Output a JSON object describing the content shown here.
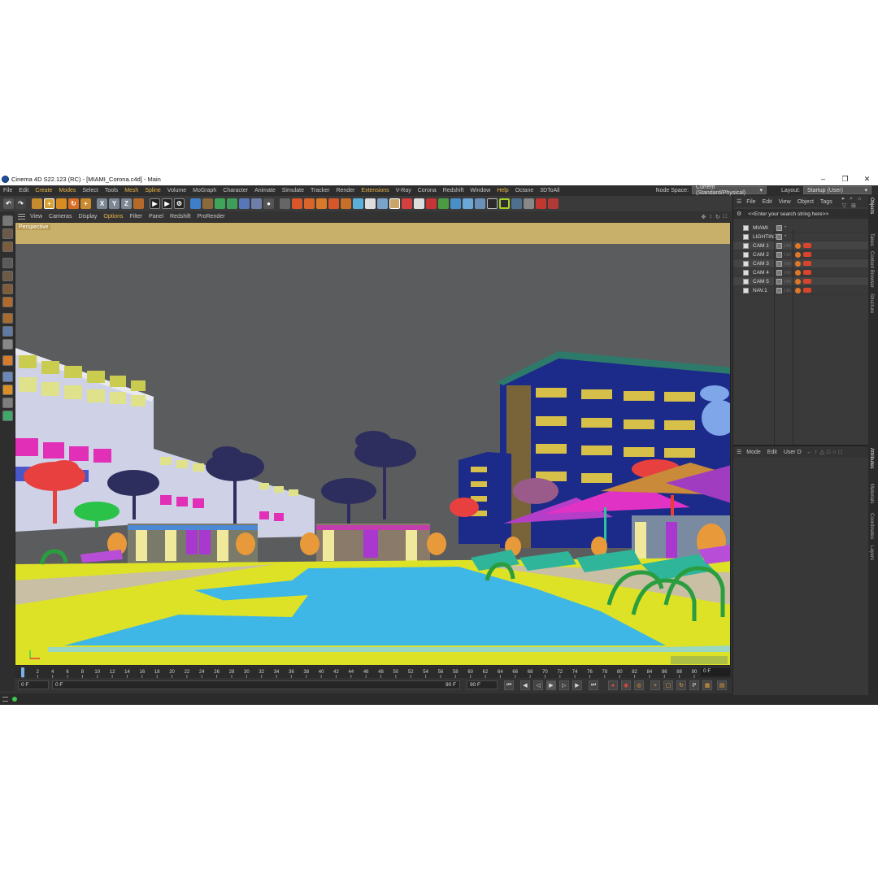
{
  "window": {
    "title": "Cinema 4D S22.123 (RC) - [MIAMI_Corona.c4d] - Main",
    "controls": [
      "–",
      "❐",
      "✕"
    ]
  },
  "menubar": {
    "items": [
      "File",
      "Edit",
      "Create",
      "Modes",
      "Select",
      "Tools",
      "Mesh",
      "Spline",
      "Volume",
      "MoGraph",
      "Character",
      "Animate",
      "Simulate",
      "Tracker",
      "Render",
      "Extensions",
      "V-Ray",
      "Corona",
      "Redshift",
      "Window",
      "Help",
      "Octane",
      "3DToAll"
    ],
    "highlighted": [
      "Create",
      "Modes",
      "Mesh",
      "Spline",
      "Extensions",
      "Help"
    ],
    "node_space_label": "Node Space:",
    "node_space_value": "Current (Standard/Physical)",
    "layout_label": "Layout:",
    "layout_value": "Startup (User)"
  },
  "toolbar": {
    "axis_buttons": [
      "X",
      "Y",
      "Z"
    ]
  },
  "viewport": {
    "menu": [
      "View",
      "Cameras",
      "Display",
      "Options",
      "Filter",
      "Panel",
      "Redshift",
      "ProRender"
    ],
    "highlighted": [
      "Options"
    ],
    "camera_label": "Perspective"
  },
  "timeline": {
    "ticks": [
      "0",
      "2",
      "4",
      "6",
      "8",
      "10",
      "12",
      "14",
      "16",
      "18",
      "20",
      "22",
      "24",
      "26",
      "28",
      "30",
      "32",
      "34",
      "36",
      "38",
      "40",
      "42",
      "44",
      "46",
      "48",
      "50",
      "52",
      "54",
      "56",
      "58",
      "60",
      "62",
      "64",
      "66",
      "68",
      "70",
      "72",
      "74",
      "76",
      "78",
      "80",
      "82",
      "84",
      "86",
      "88",
      "90"
    ],
    "current_frame": "0 F"
  },
  "transport": {
    "start": "0 F",
    "range_start": "0 F",
    "range_end": "90 F",
    "end": "90 F"
  },
  "object_manager": {
    "menu": [
      "File",
      "Edit",
      "View",
      "Object",
      "Tags"
    ],
    "search_placeholder": "<<Enter your search string here>>",
    "objects": [
      "MIAMI",
      "LIGHTING",
      "CAM 1",
      "CAM 2",
      "CAM 3",
      "CAM 4",
      "CAM 5",
      "NAV.1"
    ]
  },
  "attributes": {
    "menu": [
      "Mode",
      "Edit",
      "User D"
    ]
  },
  "side_tabs": [
    "Objects",
    "Takes",
    "Content Browser",
    "Structure",
    "Attributes",
    "Materials",
    "Coordinates",
    "Layers"
  ],
  "colors": {
    "accent": "#e8b84a",
    "pool": "#3fb7e6",
    "deck": "#dde226",
    "sky": "#5b5c5e"
  }
}
